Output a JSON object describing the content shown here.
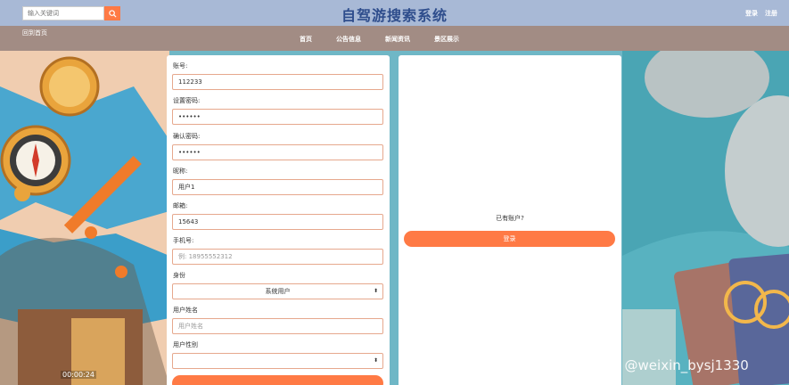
{
  "header": {
    "search_placeholder": "输入关键词",
    "site_title": "自驾游搜索系统",
    "login_link": "登录",
    "register_link": "注册"
  },
  "nav": {
    "back_link": "回到首页",
    "items": [
      "首页",
      "公告信息",
      "新闻资讯",
      "景区展示"
    ]
  },
  "form": {
    "account_label": "账号:",
    "account_value": "112233",
    "password_label": "设置密码:",
    "password_value": "••••••",
    "confirm_label": "确认密码:",
    "confirm_value": "••••••",
    "nickname_label": "昵称:",
    "nickname_value": "用户1",
    "email_label": "邮箱:",
    "email_value": "15643",
    "phone_label": "手机号:",
    "phone_placeholder": "例: 18955552312",
    "identity_label": "身份",
    "identity_value": "系统用户",
    "name_label": "用户姓名",
    "name_placeholder": "用户姓名",
    "gender_label": "用户性别",
    "gender_value": ""
  },
  "login": {
    "have_account": "已有账户?",
    "login_button": "登录"
  },
  "video": {
    "time": "00:00:24"
  },
  "watermark": "CSDN @weixin_bysj1330",
  "colors": {
    "accent": "#ff7a45",
    "header_bg": "#a8b9d6",
    "nav_bg": "#a28c84",
    "title": "#2e4d8c"
  }
}
